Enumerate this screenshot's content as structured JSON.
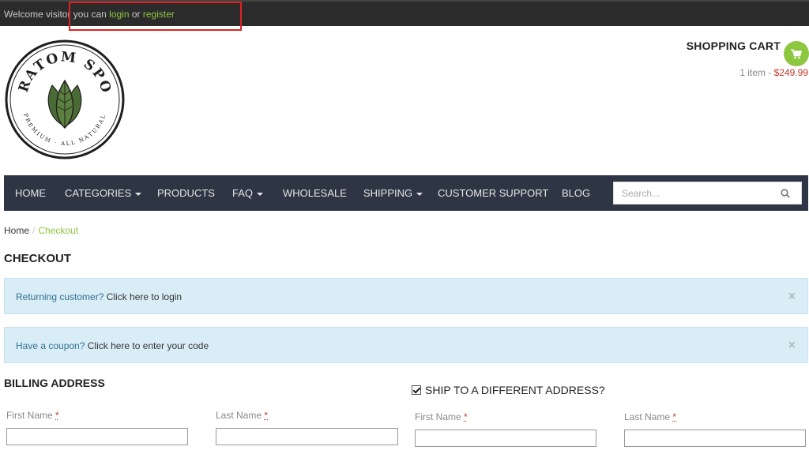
{
  "topbar": {
    "welcome_prefix": "Welcome visitor you can ",
    "login_label": "login",
    "or_label": " or ",
    "register_label": "register"
  },
  "logo": {
    "brand_text": "KRATOM SPOT",
    "tagline": "PREMIUM · ALL NATURAL",
    "icon": "kratom-leaf-logo"
  },
  "cart": {
    "title": "SHOPPING CART",
    "count_text": "1 item",
    "separator": " - ",
    "total": "$249.99",
    "icon": "cart-icon"
  },
  "nav": {
    "items": [
      {
        "label": "HOME",
        "dropdown": false
      },
      {
        "label": "CATEGORIES",
        "dropdown": true
      },
      {
        "label": "PRODUCTS",
        "dropdown": false
      },
      {
        "label": "FAQ",
        "dropdown": true
      },
      {
        "label": "WHOLESALE",
        "dropdown": false
      },
      {
        "label": "SHIPPING",
        "dropdown": true
      },
      {
        "label": "CUSTOMER SUPPORT",
        "dropdown": false
      },
      {
        "label": "BLOG",
        "dropdown": false
      }
    ],
    "search_placeholder": "Search..."
  },
  "breadcrumb": {
    "home": "Home",
    "separator": "/",
    "current": "Checkout"
  },
  "page": {
    "title": "CHECKOUT"
  },
  "notices": {
    "returning": {
      "link": "Returning customer?",
      "text": " Click here to login",
      "close": "×"
    },
    "coupon": {
      "link": "Have a coupon?",
      "text": " Click here to enter your code",
      "close": "×"
    }
  },
  "billing": {
    "title": "BILLING ADDRESS",
    "first_name_label": "First Name",
    "last_name_label": "Last Name",
    "required_mark": "*",
    "first_name_value": "",
    "last_name_value": ""
  },
  "shipping": {
    "toggle_label": "SHIP TO A DIFFERENT ADDRESS?",
    "checked": true,
    "first_name_label": "First Name",
    "last_name_label": "Last Name",
    "required_mark": "*",
    "first_name_value": "",
    "last_name_value": ""
  },
  "colors": {
    "accent": "#8dc63f",
    "nav_bg": "#2e3544",
    "topbar_bg": "#2b2b2b",
    "notice_bg": "#d9edf7",
    "price": "#c0392b",
    "highlight": "#e02020"
  }
}
